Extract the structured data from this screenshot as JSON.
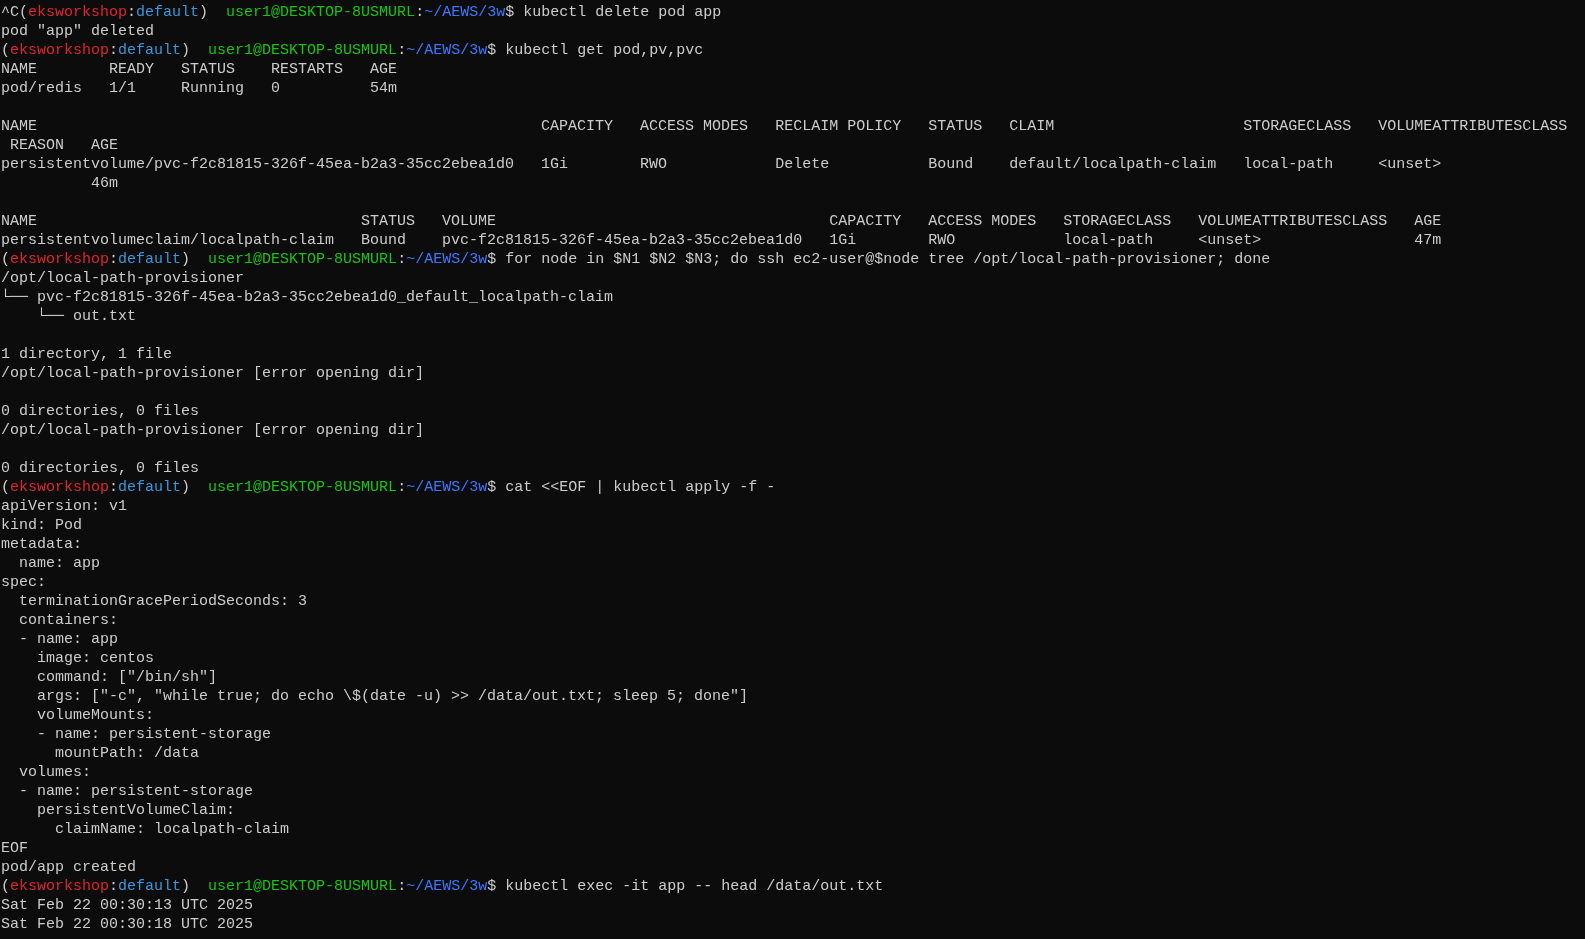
{
  "terminal": {
    "lines": [
      {
        "kind": "prompt",
        "segments": [
          {
            "text": "^C(",
            "color": "#cccccc"
          },
          {
            "text": "eksworkshop",
            "color": "#e0242e"
          },
          {
            "text": ":",
            "color": "#cccccc"
          },
          {
            "text": "default",
            "color": "#3a96dd"
          },
          {
            "text": ")  ",
            "color": "#cccccc"
          },
          {
            "text": "user1@DESKTOP-8USMURL",
            "color": "#16c60c"
          },
          {
            "text": ":",
            "color": "#cccccc"
          },
          {
            "text": "~/AEWS/3w",
            "color": "#3b78ff"
          },
          {
            "text": "$ kubectl delete pod app",
            "color": "#cccccc"
          }
        ]
      },
      {
        "kind": "output",
        "text": "pod \"app\" deleted"
      },
      {
        "kind": "prompt",
        "segments": [
          {
            "text": "(",
            "color": "#cccccc"
          },
          {
            "text": "eksworkshop",
            "color": "#e0242e"
          },
          {
            "text": ":",
            "color": "#cccccc"
          },
          {
            "text": "default",
            "color": "#3a96dd"
          },
          {
            "text": ")  ",
            "color": "#cccccc"
          },
          {
            "text": "user1@DESKTOP-8USMURL",
            "color": "#16c60c"
          },
          {
            "text": ":",
            "color": "#cccccc"
          },
          {
            "text": "~/AEWS/3w",
            "color": "#3b78ff"
          },
          {
            "text": "$ kubectl get pod,pv,pvc",
            "color": "#cccccc"
          }
        ]
      },
      {
        "kind": "output",
        "text": "NAME        READY   STATUS    RESTARTS   AGE"
      },
      {
        "kind": "output",
        "text": "pod/redis   1/1     Running   0          54m"
      },
      {
        "kind": "blank"
      },
      {
        "kind": "output",
        "text": "NAME                                                        CAPACITY   ACCESS MODES   RECLAIM POLICY   STATUS   CLAIM                     STORAGECLASS   VOLUMEATTRIBUTESCLASS"
      },
      {
        "kind": "output",
        "text": " REASON   AGE"
      },
      {
        "kind": "output",
        "text": "persistentvolume/pvc-f2c81815-326f-45ea-b2a3-35cc2ebea1d0   1Gi        RWO            Delete           Bound    default/localpath-claim   local-path     <unset>"
      },
      {
        "kind": "output",
        "text": "          46m"
      },
      {
        "kind": "blank"
      },
      {
        "kind": "output",
        "text": "NAME                                    STATUS   VOLUME                                     CAPACITY   ACCESS MODES   STORAGECLASS   VOLUMEATTRIBUTESCLASS   AGE"
      },
      {
        "kind": "output",
        "text": "persistentvolumeclaim/localpath-claim   Bound    pvc-f2c81815-326f-45ea-b2a3-35cc2ebea1d0   1Gi        RWO            local-path     <unset>                 47m"
      },
      {
        "kind": "prompt",
        "segments": [
          {
            "text": "(",
            "color": "#cccccc"
          },
          {
            "text": "eksworkshop",
            "color": "#e0242e"
          },
          {
            "text": ":",
            "color": "#cccccc"
          },
          {
            "text": "default",
            "color": "#3a96dd"
          },
          {
            "text": ")  ",
            "color": "#cccccc"
          },
          {
            "text": "user1@DESKTOP-8USMURL",
            "color": "#16c60c"
          },
          {
            "text": ":",
            "color": "#cccccc"
          },
          {
            "text": "~/AEWS/3w",
            "color": "#3b78ff"
          },
          {
            "text": "$ for node in $N1 $N2 $N3; do ssh ec2-user@$node tree /opt/local-path-provisioner; done",
            "color": "#cccccc"
          }
        ]
      },
      {
        "kind": "output",
        "text": "/opt/local-path-provisioner"
      },
      {
        "kind": "output",
        "text": "└── pvc-f2c81815-326f-45ea-b2a3-35cc2ebea1d0_default_localpath-claim"
      },
      {
        "kind": "output",
        "text": "    └── out.txt"
      },
      {
        "kind": "blank"
      },
      {
        "kind": "output",
        "text": "1 directory, 1 file"
      },
      {
        "kind": "output",
        "text": "/opt/local-path-provisioner [error opening dir]"
      },
      {
        "kind": "blank"
      },
      {
        "kind": "output",
        "text": "0 directories, 0 files"
      },
      {
        "kind": "output",
        "text": "/opt/local-path-provisioner [error opening dir]"
      },
      {
        "kind": "blank"
      },
      {
        "kind": "output",
        "text": "0 directories, 0 files"
      },
      {
        "kind": "prompt",
        "segments": [
          {
            "text": "(",
            "color": "#cccccc"
          },
          {
            "text": "eksworkshop",
            "color": "#e0242e"
          },
          {
            "text": ":",
            "color": "#cccccc"
          },
          {
            "text": "default",
            "color": "#3a96dd"
          },
          {
            "text": ")  ",
            "color": "#cccccc"
          },
          {
            "text": "user1@DESKTOP-8USMURL",
            "color": "#16c60c"
          },
          {
            "text": ":",
            "color": "#cccccc"
          },
          {
            "text": "~/AEWS/3w",
            "color": "#3b78ff"
          },
          {
            "text": "$ cat <<EOF | kubectl apply -f -",
            "color": "#cccccc"
          }
        ]
      },
      {
        "kind": "output",
        "text": "apiVersion: v1"
      },
      {
        "kind": "output",
        "text": "kind: Pod"
      },
      {
        "kind": "output",
        "text": "metadata:"
      },
      {
        "kind": "output",
        "text": "  name: app"
      },
      {
        "kind": "output",
        "text": "spec:"
      },
      {
        "kind": "output",
        "text": "  terminationGracePeriodSeconds: 3"
      },
      {
        "kind": "output",
        "text": "  containers:"
      },
      {
        "kind": "output",
        "text": "  - name: app"
      },
      {
        "kind": "output",
        "text": "    image: centos"
      },
      {
        "kind": "output",
        "text": "    command: [\"/bin/sh\"]"
      },
      {
        "kind": "output",
        "text": "    args: [\"-c\", \"while true; do echo \\$(date -u) >> /data/out.txt; sleep 5; done\"]"
      },
      {
        "kind": "output",
        "text": "    volumeMounts:"
      },
      {
        "kind": "output",
        "text": "    - name: persistent-storage"
      },
      {
        "kind": "output",
        "text": "      mountPath: /data"
      },
      {
        "kind": "output",
        "text": "  volumes:"
      },
      {
        "kind": "output",
        "text": "  - name: persistent-storage"
      },
      {
        "kind": "output",
        "text": "    persistentVolumeClaim:"
      },
      {
        "kind": "output",
        "text": "      claimName: localpath-claim"
      },
      {
        "kind": "output",
        "text": "EOF"
      },
      {
        "kind": "output",
        "text": "pod/app created"
      },
      {
        "kind": "prompt",
        "segments": [
          {
            "text": "(",
            "color": "#cccccc"
          },
          {
            "text": "eksworkshop",
            "color": "#e0242e"
          },
          {
            "text": ":",
            "color": "#cccccc"
          },
          {
            "text": "default",
            "color": "#3a96dd"
          },
          {
            "text": ")  ",
            "color": "#cccccc"
          },
          {
            "text": "user1@DESKTOP-8USMURL",
            "color": "#16c60c"
          },
          {
            "text": ":",
            "color": "#cccccc"
          },
          {
            "text": "~/AEWS/3w",
            "color": "#3b78ff"
          },
          {
            "text": "$ kubectl exec -it app -- head /data/out.txt",
            "color": "#cccccc"
          }
        ]
      },
      {
        "kind": "output",
        "text": "Sat Feb 22 00:30:13 UTC 2025"
      },
      {
        "kind": "output",
        "text": "Sat Feb 22 00:30:18 UTC 2025"
      }
    ]
  }
}
